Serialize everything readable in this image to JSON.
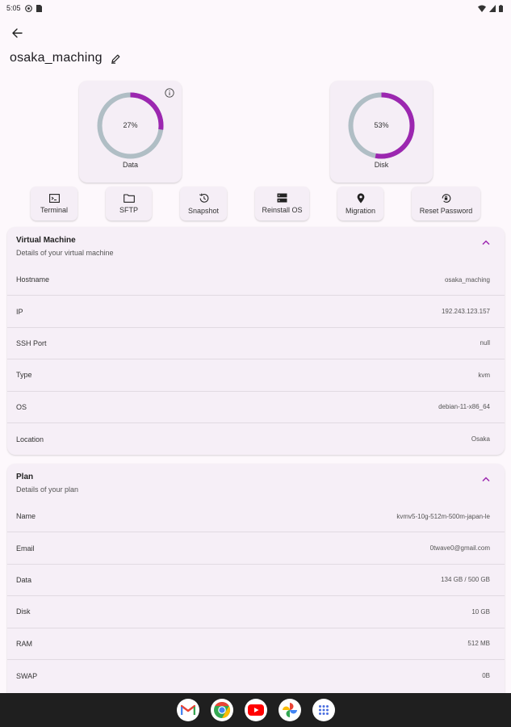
{
  "status_bar": {
    "time": "5:05"
  },
  "header": {
    "title": "osaka_maching"
  },
  "gauges": [
    {
      "label": "Data",
      "percent_text": "27%",
      "percent": 27
    },
    {
      "label": "Disk",
      "percent_text": "53%",
      "percent": 53
    }
  ],
  "actions": [
    "Terminal",
    "SFTP",
    "Snapshot",
    "Reinstall OS",
    "Migration",
    "Reset Password"
  ],
  "vm_section": {
    "title": "Virtual Machine",
    "subtitle": "Details of your virtual machine",
    "rows": [
      {
        "label": "Hostname",
        "value": "osaka_maching"
      },
      {
        "label": "IP",
        "value": "192.243.123.157"
      },
      {
        "label": "SSH Port",
        "value": "null"
      },
      {
        "label": "Type",
        "value": "kvm"
      },
      {
        "label": "OS",
        "value": "debian-11-x86_64"
      },
      {
        "label": "Location",
        "value": "Osaka"
      }
    ]
  },
  "plan_section": {
    "title": "Plan",
    "subtitle": "Details of your plan",
    "rows": [
      {
        "label": "Name",
        "value": "kvmv5-10g-512m-500m-japan-le"
      },
      {
        "label": "Email",
        "value": "0twave0@gmail.com"
      },
      {
        "label": "Data",
        "value": "134 GB / 500 GB"
      },
      {
        "label": "Disk",
        "value": "10 GB"
      },
      {
        "label": "RAM",
        "value": "512 MB"
      },
      {
        "label": "SWAP",
        "value": "0B"
      }
    ]
  },
  "dock_apps": [
    "gmail-icon",
    "chrome-icon",
    "youtube-icon",
    "photos-icon",
    "app-drawer-icon"
  ],
  "colors": {
    "accent": "#9c27b0",
    "track": "#b0bec5",
    "background": "#fdf8fc",
    "card": "#f5eef6",
    "nav_bar": "#1f1f1f"
  }
}
